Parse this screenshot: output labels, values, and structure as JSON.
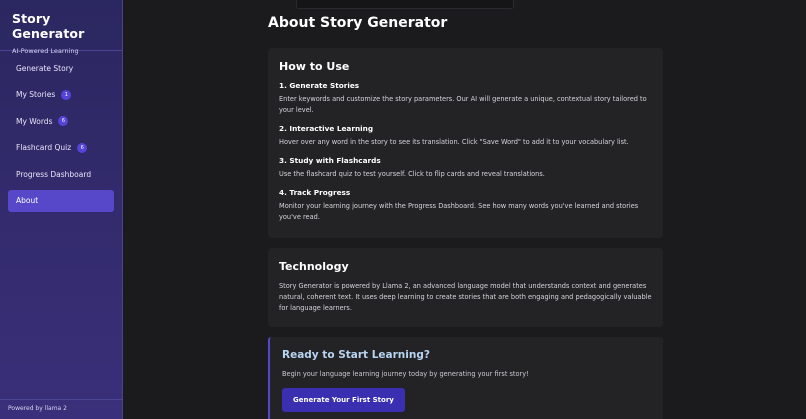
{
  "sidebar": {
    "title": "Story Generator",
    "subtitle": "AI-Powered Learning",
    "items": [
      {
        "label": "Generate Story",
        "badge": null
      },
      {
        "label": "My Stories",
        "badge": "1"
      },
      {
        "label": "My Words",
        "badge": "6"
      },
      {
        "label": "Flashcard Quiz",
        "badge": "6"
      },
      {
        "label": "Progress Dashboard",
        "badge": null
      },
      {
        "label": "About",
        "badge": null,
        "active": true
      }
    ],
    "footer": "Powered by llama 2"
  },
  "main": {
    "title": "About Story Generator",
    "how_to_use": {
      "heading": "How to Use",
      "steps": [
        {
          "title": "1. Generate Stories",
          "desc": "Enter keywords and customize the story parameters. Our AI will generate a unique, contextual story tailored to your level."
        },
        {
          "title": "2. Interactive Learning",
          "desc": "Hover over any word in the story to see its translation. Click \"Save Word\" to add it to your vocabulary list."
        },
        {
          "title": "3. Study with Flashcards",
          "desc": "Use the flashcard quiz to test yourself. Click to flip cards and reveal translations."
        },
        {
          "title": "4. Track Progress",
          "desc": "Monitor your learning journey with the Progress Dashboard. See how many words you've learned and stories you've read."
        }
      ]
    },
    "technology": {
      "heading": "Technology",
      "text": "Story Generator is powered by Llama 2, an advanced language model that understands context and generates natural, coherent text. It uses deep learning to create stories that are both engaging and pedagogically valuable for language learners."
    },
    "cta": {
      "heading": "Ready to Start Learning?",
      "text": "Begin your language learning journey today by generating your first story!",
      "button": "Generate Your First Story"
    }
  }
}
